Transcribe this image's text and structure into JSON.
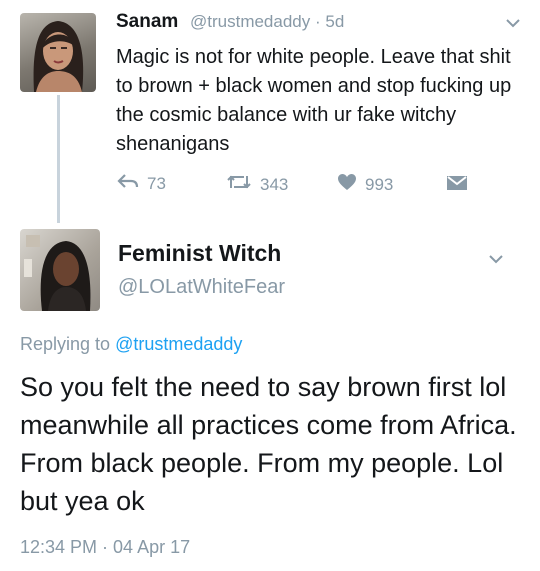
{
  "tweet1": {
    "name": "Sanam",
    "handle": "@trustmedaddy",
    "separator": "·",
    "age": "5d",
    "body": "Magic is not for white people. Leave that shit to brown + black women and stop fucking up the cosmic balance with ur fake witchy shenanigans",
    "reply_count": "73",
    "retweet_count": "343",
    "like_count": "993",
    "icons": [
      "reply-icon",
      "retweet-icon",
      "heart-icon",
      "direct-message-icon",
      "chevron-down-icon"
    ]
  },
  "tweet2": {
    "name": "Feminist Witch",
    "handle": "@LOLatWhiteFear",
    "replying_label": "Replying to",
    "replying_handle": "@trustmedaddy",
    "body": "So you felt the need to say brown first lol meanwhile all practices come from Africa. From black people. From my people. Lol but yea ok",
    "timestamp": "12:34 PM · 04 Apr 17"
  },
  "colors": {
    "text": "#14171a",
    "muted": "#8899a6",
    "link": "#1da1f2",
    "thread_line": "#c8d3dc"
  }
}
